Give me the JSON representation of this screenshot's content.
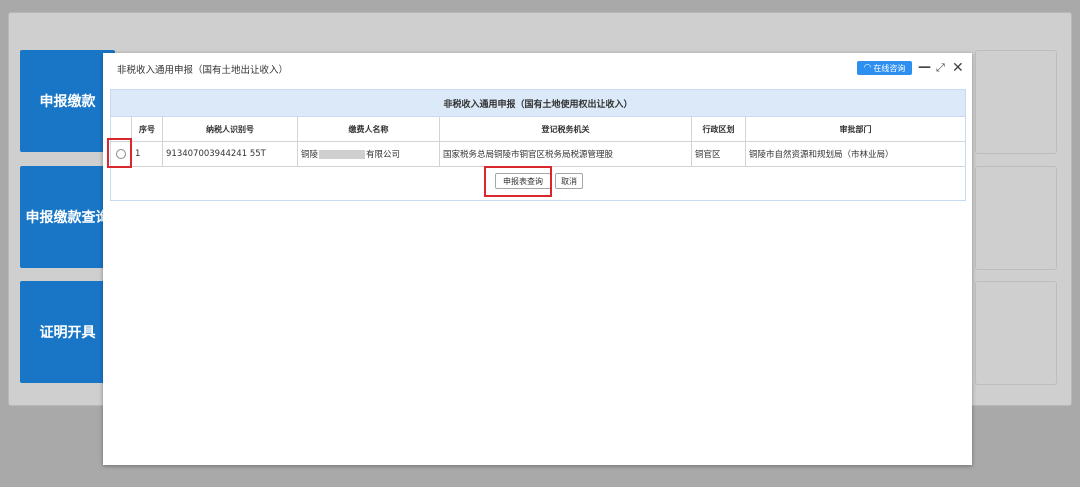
{
  "background": {
    "buttons": [
      {
        "label": "申报缴款"
      },
      {
        "label": "申报缴款查询"
      },
      {
        "label": "证明开具"
      }
    ]
  },
  "modal": {
    "title": "非税收入通用申报（国有土地出让收入）",
    "consult_label": "在线咨询",
    "minimize_symbol": "—",
    "maximize_symbol": "⤢",
    "close_symbol": "✕"
  },
  "grid": {
    "title": "非税收入通用申报（国有土地使用权出让收入）",
    "headers": [
      "",
      "序号",
      "纳税人识别号",
      "缴费人名称",
      "登记税务机关",
      "行政区划",
      "审批部门"
    ],
    "rows": [
      {
        "index": "1",
        "taxpayer_id": "913407003944241 55T",
        "payer_prefix": "铜陵",
        "payer_suffix": "有限公司",
        "tax_office": "国家税务总局铜陵市铜官区税务局税源管理股",
        "district": "铜官区",
        "approval_dept": "铜陵市自然资源和规划局（市林业局）"
      }
    ]
  },
  "actions": {
    "query_label": "申报表查询",
    "cancel_label": "取消"
  },
  "colors": {
    "accent": "#1976c6",
    "highlight": "#d9272e",
    "grid_header": "#dbe9f8"
  }
}
